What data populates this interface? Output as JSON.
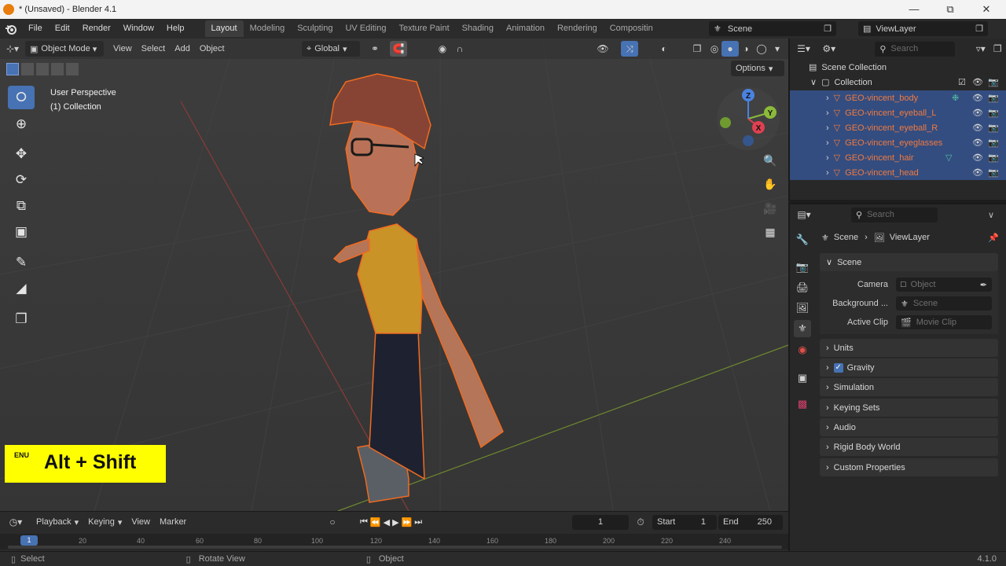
{
  "window": {
    "title": "* (Unsaved) - Blender 4.1",
    "minimize": "—",
    "maximize": "⧉",
    "close": "✕"
  },
  "menus": [
    "File",
    "Edit",
    "Render",
    "Window",
    "Help"
  ],
  "workspaces": [
    "Layout",
    "Modeling",
    "Sculpting",
    "UV Editing",
    "Texture Paint",
    "Shading",
    "Animation",
    "Rendering",
    "Compositin"
  ],
  "scene": {
    "label": "Scene"
  },
  "view_layer": {
    "label": "ViewLayer"
  },
  "viewport": {
    "mode": "Object Mode",
    "menus": [
      "View",
      "Select",
      "Add",
      "Object"
    ],
    "transform_orientation": "Global",
    "options": "Options",
    "perspective": "User Perspective",
    "collection_info": "(1) Collection",
    "gizmo": {
      "x": "X",
      "y": "Y",
      "z": "Z"
    }
  },
  "outliner": {
    "search_placeholder": "Search",
    "scene_collection": "Scene Collection",
    "collection": "Collection",
    "objects": [
      "GEO-vincent_body",
      "GEO-vincent_eyeball_L",
      "GEO-vincent_eyeball_R",
      "GEO-vincent_eyeglasses",
      "GEO-vincent_hair",
      "GEO-vincent_head"
    ]
  },
  "properties": {
    "search_placeholder": "Search",
    "breadcrumb": {
      "scene": "Scene",
      "view_layer": "ViewLayer"
    },
    "scene_panel": "Scene",
    "fields": {
      "camera_label": "Camera",
      "camera_placeholder": "Object",
      "background_label": "Background ...",
      "background_placeholder": "Scene",
      "active_clip_label": "Active Clip",
      "active_clip_placeholder": "Movie Clip"
    },
    "panels": [
      "Units",
      "Gravity",
      "Simulation",
      "Keying Sets",
      "Audio",
      "Rigid Body World",
      "Custom Properties"
    ],
    "gravity_checked": true
  },
  "timeline": {
    "menus": [
      "Playback",
      "Keying",
      "View",
      "Marker"
    ],
    "current_frame": "1",
    "start_label": "Start",
    "start": "1",
    "end_label": "End",
    "end": "250",
    "ruler_ticks": [
      "1",
      "20",
      "40",
      "60",
      "80",
      "100",
      "120",
      "140",
      "160",
      "180",
      "200",
      "220",
      "240"
    ]
  },
  "statusbar": {
    "select": "Select",
    "rotate_view": "Rotate View",
    "object": "Object",
    "version": "4.1.0"
  },
  "overlay": {
    "lang": "ENU",
    "shortcut": "Alt + Shift"
  },
  "colors": {
    "accent_blue": "#4772b3",
    "selected_row": "#334d80",
    "object_name_orange": "#f27a3e",
    "overlay_yellow": "#ffff00"
  }
}
